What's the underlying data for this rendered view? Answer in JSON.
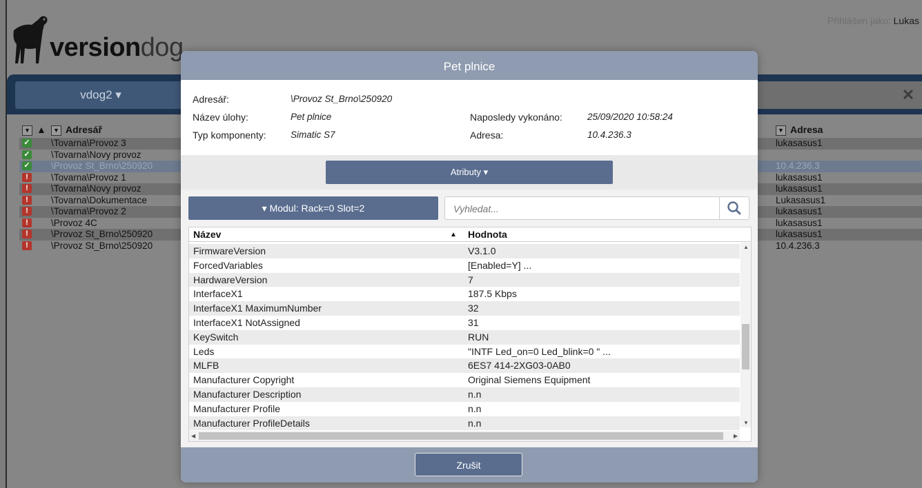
{
  "brand": {
    "name_bold": "version",
    "name_light": "dog"
  },
  "user": {
    "label": "Přihlášen jako:",
    "name": "Lukas"
  },
  "topbar": {
    "project": "vdog2 ▾",
    "close": "✕"
  },
  "background_table": {
    "headers": {
      "directory": "Adresář",
      "address": "Adresa"
    },
    "rows": [
      {
        "status": "ok",
        "dir": "\\Tovarna\\Provoz 3",
        "addr": "lukasasus1"
      },
      {
        "status": "ok",
        "dir": "\\Tovarna\\Novy provoz",
        "addr": ""
      },
      {
        "status": "ok",
        "dir": "\\Provoz St_Brno\\250920",
        "addr": "10.4.236.3"
      },
      {
        "status": "err",
        "dir": "\\Tovarna\\Provoz 1",
        "addr": "lukasasus1"
      },
      {
        "status": "err",
        "dir": "\\Tovarna\\Novy provoz",
        "addr": "lukasasus1"
      },
      {
        "status": "err",
        "dir": "\\Tovarna\\Dokumentace",
        "addr": "Lukasasus1"
      },
      {
        "status": "err",
        "dir": "\\Tovarna\\Provoz 2",
        "addr": "lukasasus1"
      },
      {
        "status": "err",
        "dir": "\\Provoz 4C",
        "addr": "lukasasus1"
      },
      {
        "status": "err",
        "dir": "\\Provoz St_Brno\\250920",
        "addr": "lukasasus1"
      },
      {
        "status": "err",
        "dir": "\\Provoz St_Brno\\250920",
        "addr": "10.4.236.3"
      }
    ]
  },
  "modal": {
    "title": "Pet plnice",
    "info": {
      "dir_label": "Adresář:",
      "dir_value": "\\Provoz St_Brno\\250920",
      "task_label": "Název úlohy:",
      "task_value": "Pet plnice",
      "type_label": "Typ komponenty:",
      "type_value": "Simatic S7",
      "last_label": "Naposledy vykonáno:",
      "last_value": "25/09/2020 10:58:24",
      "addr_label": "Adresa:",
      "addr_value": "10.4.236.3"
    },
    "attributes_button": "Atributy ▾",
    "module_button": "▾ Modul: Rack=0 Slot=2",
    "search_placeholder": "Vyhledat...",
    "grid": {
      "col_name": "Název",
      "col_value": "Hodnota",
      "rows": [
        {
          "name": "FirmwareVersion",
          "value": "V3.1.0"
        },
        {
          "name": "ForcedVariables",
          "value": "[Enabled=Y] ..."
        },
        {
          "name": "HardwareVersion",
          "value": "7"
        },
        {
          "name": "InterfaceX1",
          "value": "187.5 Kbps"
        },
        {
          "name": "InterfaceX1 MaximumNumber",
          "value": "32"
        },
        {
          "name": "InterfaceX1 NotAssigned",
          "value": "31"
        },
        {
          "name": "KeySwitch",
          "value": "RUN"
        },
        {
          "name": "Leds",
          "value": "\"INTF Led_on=0 Led_blink=0 \" ..."
        },
        {
          "name": "MLFB",
          "value": "6ES7 414-2XG03-0AB0"
        },
        {
          "name": "Manufacturer Copyright",
          "value": "Original Siemens Equipment"
        },
        {
          "name": "Manufacturer Description",
          "value": "n.n"
        },
        {
          "name": "Manufacturer Profile",
          "value": "n.n"
        },
        {
          "name": "Manufacturer ProfileDetails",
          "value": "n.n"
        }
      ]
    },
    "cancel_button": "Zrušit"
  },
  "colors": {
    "modal_header": "#8f9bb0",
    "button": "#5a6d8f",
    "topbar": "#1e3552",
    "ok": "#3a8a3a",
    "error": "#b3352c"
  }
}
